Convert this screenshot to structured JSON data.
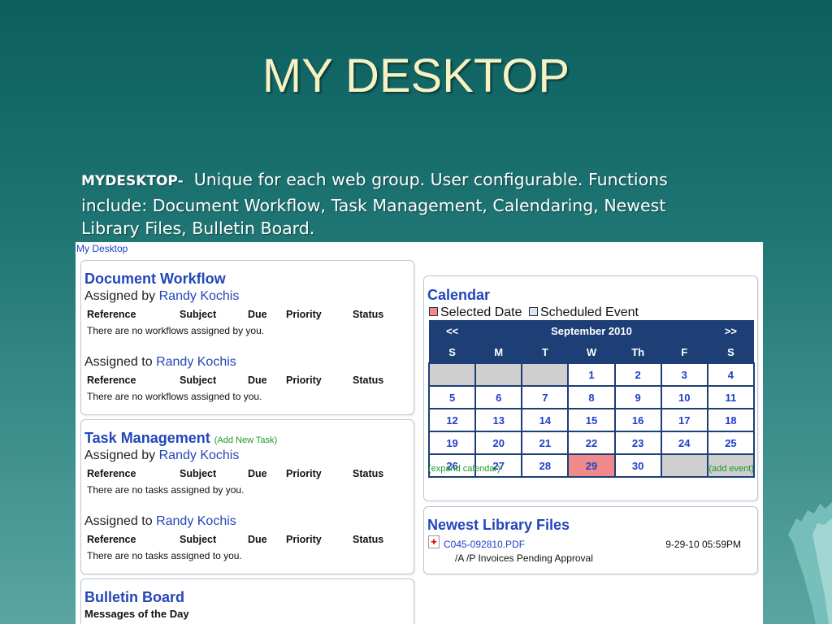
{
  "slide": {
    "title": "MY DESKTOP",
    "desc_lead": "MYDESKTOP-",
    "desc_line1": "Unique for each web group.   User configurable.  Functions",
    "desc_line2": "include: Document Workflow, Task Management, Calendaring, Newest",
    "desc_line3": "Library Files, Bulletin Board."
  },
  "app": {
    "title": "My Desktop"
  },
  "columns": [
    "Reference",
    "Subject",
    "Due",
    "Priority",
    "Status"
  ],
  "workflow": {
    "heading": "Document Workflow",
    "by_prefix": "Assigned by",
    "to_prefix": "Assigned to",
    "user": "Randy Kochis",
    "empty_by": "There are no workflows assigned by you.",
    "empty_to": "There are no workflows assigned to you."
  },
  "tasks": {
    "heading": "Task Management",
    "add_link": "(Add New Task)",
    "by_prefix": "Assigned by",
    "to_prefix": "Assigned to",
    "user": "Randy Kochis",
    "empty_by": "There are no tasks assigned by you.",
    "empty_to": "There are no tasks assigned to you."
  },
  "bulletin": {
    "heading": "Bulletin Board",
    "subheading": "Messages of the Day"
  },
  "calendar": {
    "heading": "Calendar",
    "legend_selected": "Selected Date",
    "legend_scheduled": "Scheduled Event",
    "prev": "<<",
    "next": ">>",
    "month": "September 2010",
    "days_of_week": [
      "S",
      "M",
      "T",
      "W",
      "Th",
      "F",
      "S"
    ],
    "weeks": [
      [
        "",
        "",
        "",
        "1",
        "2",
        "3",
        "4"
      ],
      [
        "5",
        "6",
        "7",
        "8",
        "9",
        "10",
        "11"
      ],
      [
        "12",
        "13",
        "14",
        "15",
        "16",
        "17",
        "18"
      ],
      [
        "19",
        "20",
        "21",
        "22",
        "23",
        "24",
        "25"
      ],
      [
        "26",
        "27",
        "28",
        "29",
        "30",
        "",
        ""
      ]
    ],
    "selected_day": "29",
    "expand_link": "(expand calendar)",
    "add_event_link": "(add event)",
    "colors": {
      "selected": "#f08a8a",
      "header": "#1d3f76",
      "blank": "#cfcfcf"
    }
  },
  "library": {
    "heading": "Newest Library Files",
    "file_name": "C045-092810.PDF",
    "file_date": "9-29-10 05:59PM",
    "file_desc": "/A /P Invoices Pending Approval",
    "icon": "pdf-icon"
  }
}
